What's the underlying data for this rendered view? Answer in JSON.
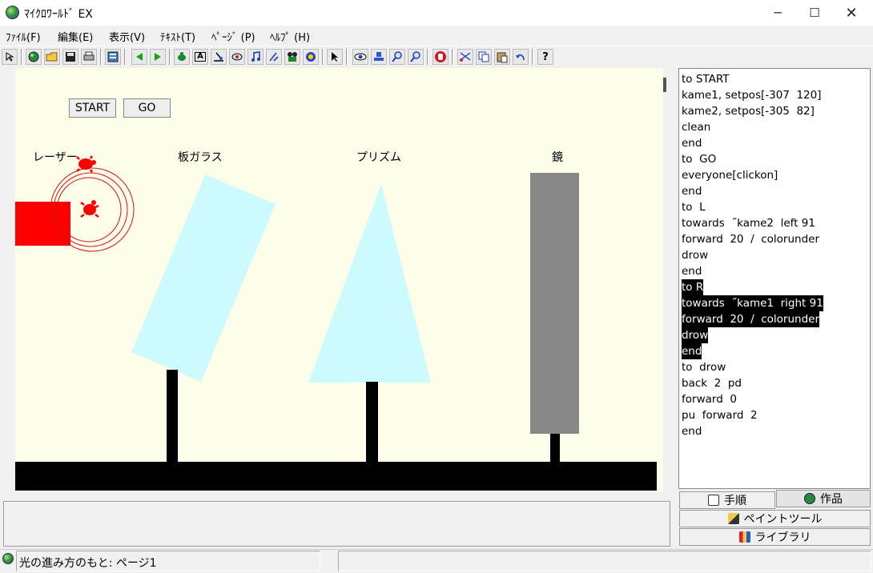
{
  "app": {
    "title": "ﾏｲｸﾛﾜｰﾙﾄﾞ EX",
    "minimize": "─",
    "maximize": "☐",
    "close": "✕"
  },
  "menu": [
    {
      "label": "ﾌｧｲﾙ(F)"
    },
    {
      "label": "編集(E)"
    },
    {
      "label": "表示(V)"
    },
    {
      "label": "ﾃｷｽﾄ(T)"
    },
    {
      "label": "ﾍﾟｰｼﾞ (P)"
    },
    {
      "label": "ﾍﾙﾌﾟ (H)"
    }
  ],
  "toolbar": {
    "text_tool_glyph": "A",
    "help_glyph": "?"
  },
  "canvas": {
    "background": "#fefdea",
    "start_button": "START",
    "go_button": "GO",
    "labels": {
      "laser": "レーザー",
      "glass": "板ガラス",
      "prism": "プリズム",
      "mirror": "鏡"
    },
    "colors": {
      "laser": "#ff0000",
      "glass": "#ccfbfd",
      "mirror": "#888888",
      "ground": "#000000"
    }
  },
  "code": [
    {
      "text": "to START",
      "selected": false
    },
    {
      "text": "kame1, setpos[-307  120]",
      "selected": false
    },
    {
      "text": "kame2, setpos[-305  82]",
      "selected": false
    },
    {
      "text": "clean",
      "selected": false
    },
    {
      "text": "end",
      "selected": false
    },
    {
      "text": "to  GO",
      "selected": false
    },
    {
      "text": "everyone[clickon]",
      "selected": false
    },
    {
      "text": "end",
      "selected": false
    },
    {
      "text": "to  L",
      "selected": false
    },
    {
      "text": "towards  ˝kame2  left 91",
      "selected": false
    },
    {
      "text": "forward  20  /  colorunder",
      "selected": false
    },
    {
      "text": "drow",
      "selected": false
    },
    {
      "text": "end",
      "selected": false
    },
    {
      "text": "to R",
      "selected": true
    },
    {
      "text": "towards  ˝kame1  right 91",
      "selected": true
    },
    {
      "text": "forward  20  /  colorunder",
      "selected": true
    },
    {
      "text": "drow",
      "selected": true
    },
    {
      "text": "end",
      "selected": true
    },
    {
      "text": "to  drow",
      "selected": false
    },
    {
      "text": "back  2  pd",
      "selected": false
    },
    {
      "text": "forward  0",
      "selected": false
    },
    {
      "text": "pu  forward  2",
      "selected": false
    },
    {
      "text": "end",
      "selected": false
    }
  ],
  "side_tabs": {
    "procedure": "手順",
    "works": "作品",
    "paint": "ペイントツール",
    "library": "ライブラリ"
  },
  "status": {
    "left": "光の進み方のもと: ページ1",
    "right": ""
  }
}
